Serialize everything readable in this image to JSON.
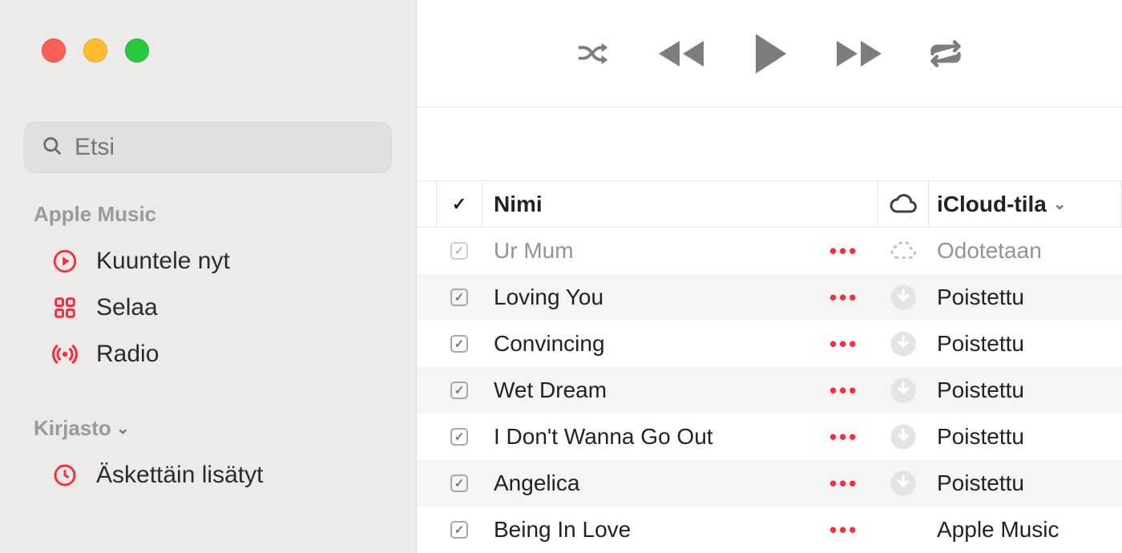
{
  "search": {
    "placeholder": "Etsi"
  },
  "sidebar": {
    "sections": [
      {
        "title": "Apple Music",
        "items": [
          {
            "label": "Kuuntele nyt",
            "icon": "play-circle"
          },
          {
            "label": "Selaa",
            "icon": "grid"
          },
          {
            "label": "Radio",
            "icon": "broadcast"
          }
        ]
      },
      {
        "title": "Kirjasto",
        "collapsible": true,
        "items": [
          {
            "label": "Äskettäin lisätyt",
            "icon": "clock"
          }
        ]
      }
    ]
  },
  "columns": {
    "check": "✓",
    "name": "Nimi",
    "status": "iCloud-tila"
  },
  "tracks": [
    {
      "name": "Ur Mum",
      "checked": true,
      "dim": true,
      "cloud": "waiting",
      "status": "Odotetaan"
    },
    {
      "name": "Loving You",
      "checked": true,
      "dim": false,
      "cloud": "removed",
      "status": "Poistettu"
    },
    {
      "name": "Convincing",
      "checked": true,
      "dim": false,
      "cloud": "removed",
      "status": "Poistettu"
    },
    {
      "name": "Wet Dream",
      "checked": true,
      "dim": false,
      "cloud": "removed",
      "status": "Poistettu"
    },
    {
      "name": "I Don't Wanna Go Out",
      "checked": true,
      "dim": false,
      "cloud": "removed",
      "status": "Poistettu"
    },
    {
      "name": "Angelica",
      "checked": true,
      "dim": false,
      "cloud": "removed",
      "status": "Poistettu"
    },
    {
      "name": "Being In Love",
      "checked": true,
      "dim": false,
      "cloud": "none",
      "status": "Apple Music"
    }
  ]
}
